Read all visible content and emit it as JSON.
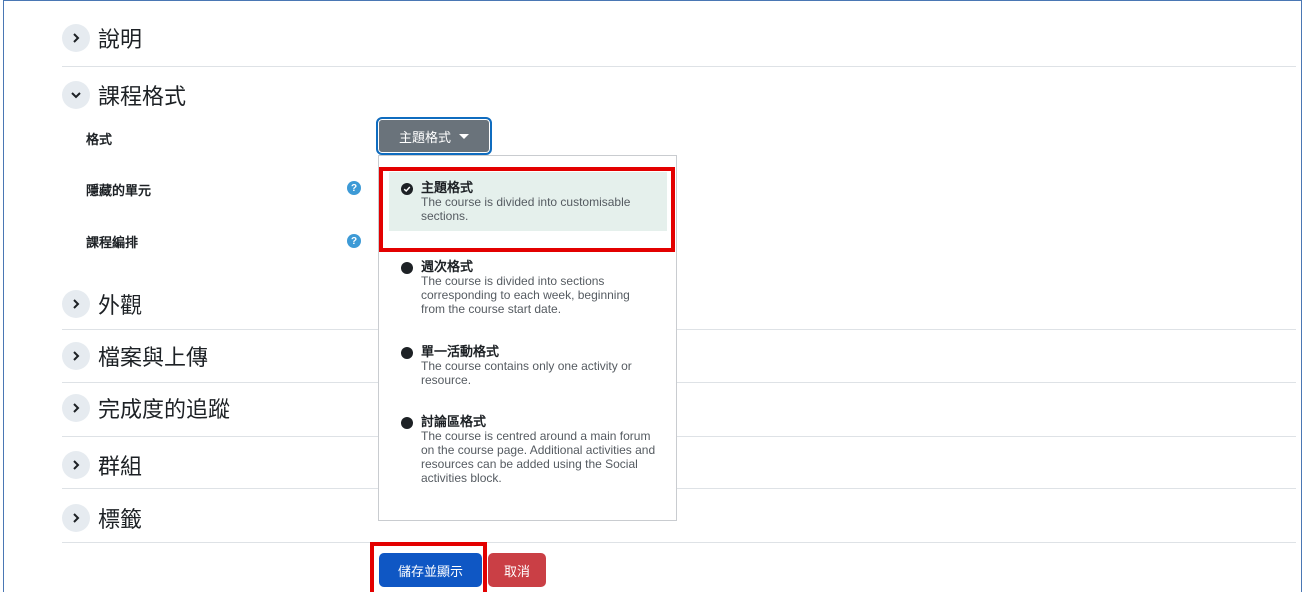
{
  "sections": {
    "description": "說明",
    "course_format": "課程格式",
    "appearance": "外觀",
    "files_uploads": "檔案與上傳",
    "completion": "完成度的追蹤",
    "groups": "群組",
    "tags": "標籤"
  },
  "format_rows": {
    "format_label": "格式",
    "hidden_sections_label": "隱藏的單元",
    "course_layout_label": "課程編排",
    "help_glyph": "?"
  },
  "format_select": {
    "value": "主題格式"
  },
  "format_options": [
    {
      "title": "主題格式",
      "desc": "The course is divided into customisable sections.",
      "selected": true
    },
    {
      "title": "週次格式",
      "desc": "The course is divided into sections corresponding to each week, beginning from the course start date.",
      "selected": false
    },
    {
      "title": "單一活動格式",
      "desc": "The course contains only one activity or resource.",
      "selected": false
    },
    {
      "title": "討論區格式",
      "desc": "The course is centred around a main forum on the course page. Additional activities and resources can be added using the Social activities block.",
      "selected": false
    }
  ],
  "buttons": {
    "save": "儲存並顯示",
    "cancel": "取消"
  },
  "colors": {
    "primary": "#0f57c4",
    "danger": "#ca3f45",
    "highlight": "#e30000",
    "selected_bg": "#e5f0ec"
  }
}
